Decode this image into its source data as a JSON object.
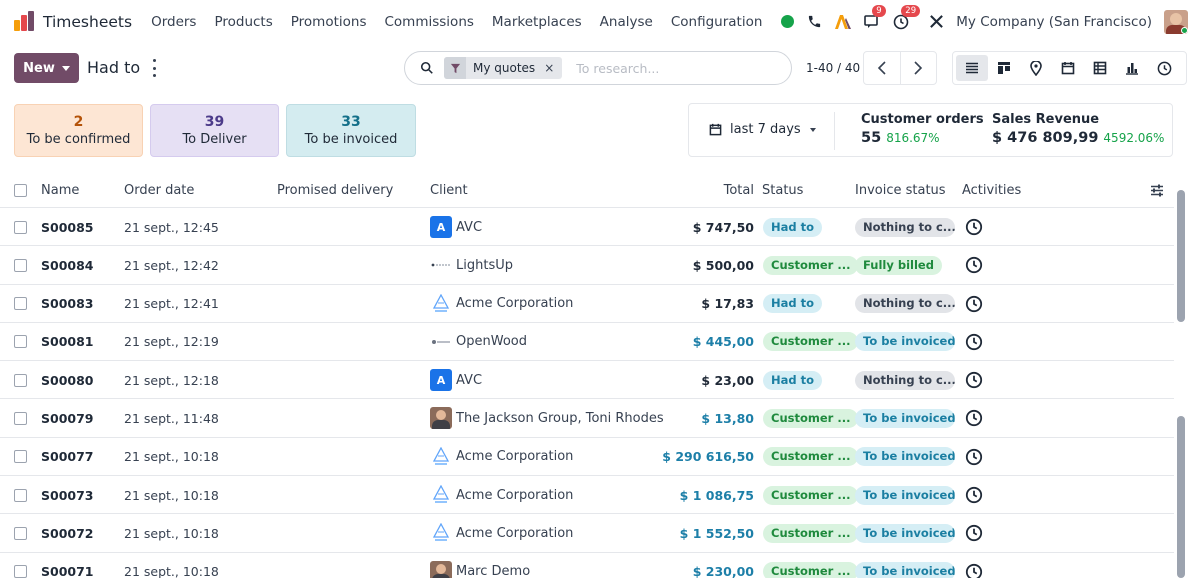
{
  "app": {
    "name": "Timesheets",
    "menu": [
      "Orders",
      "Products",
      "Promotions",
      "Commissions",
      "Marketplaces",
      "Analyse",
      "Configuration"
    ],
    "messages_badge": "9",
    "activities_badge": "29",
    "company": "My Company (San Francisco)",
    "brand_color": "#714b67"
  },
  "control": {
    "new_label": "New",
    "title": "Had to",
    "facet_label": "My quotes",
    "facet_close": "×",
    "search_placeholder": "To research...",
    "pager": "1-40 / 40"
  },
  "cards": [
    {
      "count": "2",
      "label": "To be confirmed"
    },
    {
      "count": "39",
      "label": "To Deliver"
    },
    {
      "count": "33",
      "label": "To be invoiced"
    }
  ],
  "kpi": {
    "date_filter": "last 7 days",
    "orders_title": "Customer orders",
    "orders_value": "55",
    "orders_pct": "816.67%",
    "revenue_title": "Sales Revenue",
    "revenue_value": "$ 476 809,99",
    "revenue_pct": "4592.06%"
  },
  "table": {
    "headers": {
      "name": "Name",
      "order_date": "Order date",
      "promised": "Promised delivery",
      "client": "Client",
      "total": "Total",
      "status": "Status",
      "invoice": "Invoice status",
      "activities": "Activities"
    },
    "rows": [
      {
        "name": "S00085",
        "date": "21 sept., 12:45",
        "client": "AVC",
        "logo": "letter-a",
        "total": "$ 747,50",
        "total_blue": false,
        "status": "Had to",
        "status_color": "blue",
        "invoice": "Nothing to c...",
        "invoice_color": "gray"
      },
      {
        "name": "S00084",
        "date": "21 sept., 12:42",
        "client": "LightsUp",
        "logo": "lightsup-logo",
        "total": "$ 500,00",
        "total_blue": false,
        "status": "Customer ...",
        "status_color": "green",
        "invoice": "Fully billed",
        "invoice_color": "green"
      },
      {
        "name": "S00083",
        "date": "21 sept., 12:41",
        "client": "Acme Corporation",
        "logo": "acme-logo",
        "total": "$ 17,83",
        "total_blue": false,
        "status": "Had to",
        "status_color": "blue",
        "invoice": "Nothing to c...",
        "invoice_color": "gray"
      },
      {
        "name": "S00081",
        "date": "21 sept., 12:19",
        "client": "OpenWood",
        "logo": "openwood-logo",
        "total": "$ 445,00",
        "total_blue": true,
        "status": "Customer ...",
        "status_color": "green",
        "invoice": "To be invoiced",
        "invoice_color": "blue"
      },
      {
        "name": "S00080",
        "date": "21 sept., 12:18",
        "client": "AVC",
        "logo": "letter-a",
        "total": "$ 23,00",
        "total_blue": false,
        "status": "Had to",
        "status_color": "blue",
        "invoice": "Nothing to c...",
        "invoice_color": "gray"
      },
      {
        "name": "S00079",
        "date": "21 sept., 11:48",
        "client": "The Jackson Group, Toni Rhodes",
        "logo": "person-photo",
        "total": "$ 13,80",
        "total_blue": true,
        "status": "Customer ...",
        "status_color": "green",
        "invoice": "To be invoiced",
        "invoice_color": "blue"
      },
      {
        "name": "S00077",
        "date": "21 sept., 10:18",
        "client": "Acme Corporation",
        "logo": "acme-logo",
        "total": "$ 290 616,50",
        "total_blue": true,
        "status": "Customer ...",
        "status_color": "green",
        "invoice": "To be invoiced",
        "invoice_color": "blue"
      },
      {
        "name": "S00073",
        "date": "21 sept., 10:18",
        "client": "Acme Corporation",
        "logo": "acme-logo",
        "total": "$ 1 086,75",
        "total_blue": true,
        "status": "Customer ...",
        "status_color": "green",
        "invoice": "To be invoiced",
        "invoice_color": "blue"
      },
      {
        "name": "S00072",
        "date": "21 sept., 10:18",
        "client": "Acme Corporation",
        "logo": "acme-logo",
        "total": "$ 1 552,50",
        "total_blue": true,
        "status": "Customer ...",
        "status_color": "green",
        "invoice": "To be invoiced",
        "invoice_color": "blue"
      },
      {
        "name": "S00071",
        "date": "21 sept., 10:18",
        "client": "Marc Demo",
        "logo": "person-photo",
        "total": "$ 230,00",
        "total_blue": true,
        "status": "Customer ...",
        "status_color": "green",
        "invoice": "To be invoiced",
        "invoice_color": "blue"
      }
    ]
  }
}
